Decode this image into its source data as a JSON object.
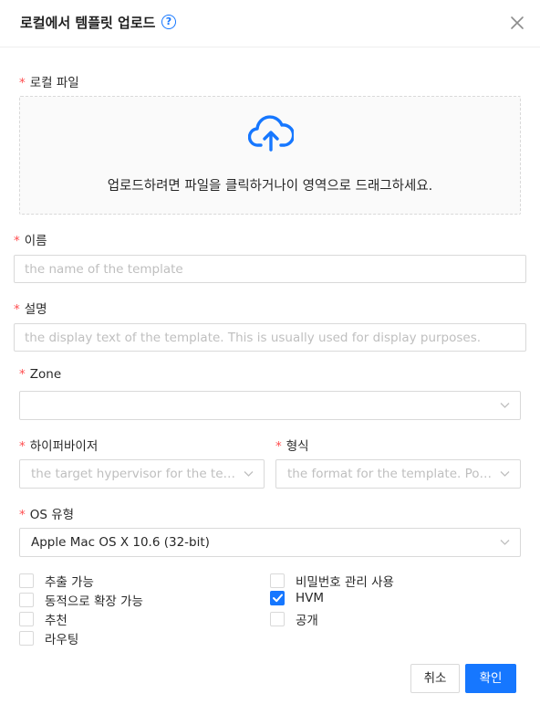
{
  "dialog": {
    "title": "로컬에서 템플릿 업로드",
    "help_glyph": "?"
  },
  "form": {
    "required_mark": "*",
    "file": {
      "label": "로컬 파일",
      "hint": "업로드하려면 파일을 클릭하거나이 영역으로 드래그하세요."
    },
    "name": {
      "label": "이름",
      "placeholder": "the name of the template",
      "value": ""
    },
    "description": {
      "label": "설명",
      "placeholder": "the display text of the template. This is usually used for display purposes.",
      "value": ""
    },
    "zone": {
      "label": "Zone",
      "value": ""
    },
    "hypervisor": {
      "label": "하이퍼바이저",
      "placeholder": "the target hypervisor for the tem..."
    },
    "format": {
      "label": "형식",
      "placeholder": "the format for the template. Pos..."
    },
    "os_type": {
      "label": "OS 유형",
      "value": "Apple Mac OS X 10.6 (32-bit)"
    },
    "checkboxes": [
      {
        "label": "추출 가능",
        "checked": false
      },
      {
        "label": "동적으로 확장 가능",
        "checked": false
      },
      {
        "label": "추천",
        "checked": false
      },
      {
        "label": "라우팅",
        "checked": false
      },
      {
        "label": "비밀번호 관리 사용",
        "checked": false
      },
      {
        "label": "HVM",
        "checked": true
      },
      {
        "label": "공개",
        "checked": false
      }
    ]
  },
  "footer": {
    "cancel_label": "취소",
    "ok_label": "확인"
  },
  "colors": {
    "accent": "#1677ff",
    "required": "#ff4d4f",
    "border": "#d9d9d9",
    "placeholder": "#bfbfbf"
  }
}
